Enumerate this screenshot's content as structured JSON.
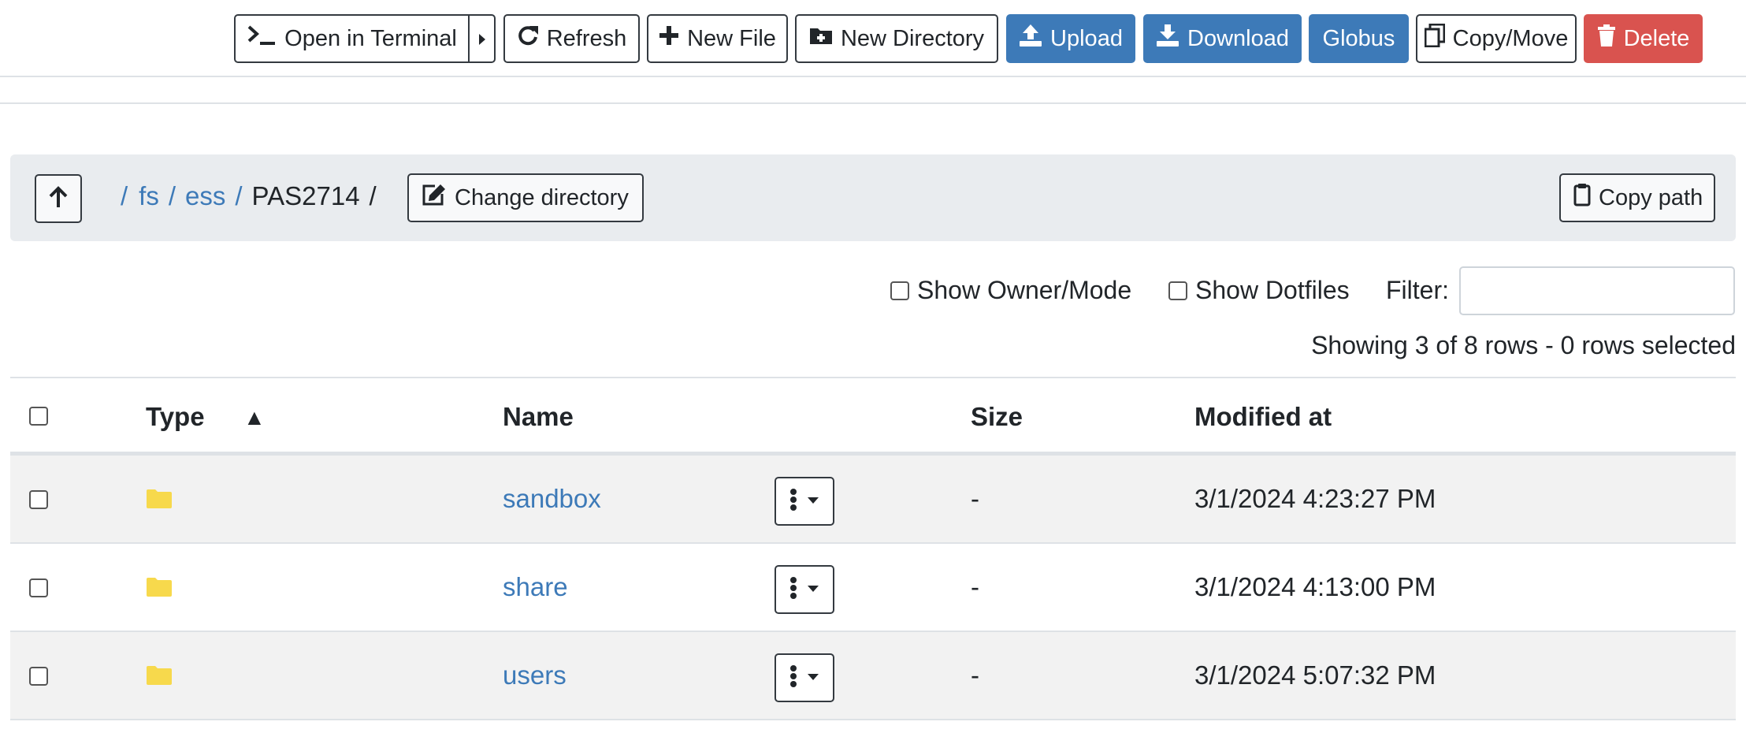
{
  "toolbar": {
    "open_terminal": "Open in Terminal",
    "refresh": "Refresh",
    "new_file": "New File",
    "new_directory": "New Directory",
    "upload": "Upload",
    "download": "Download",
    "globus": "Globus",
    "copy_move": "Copy/Move",
    "delete": "Delete"
  },
  "path": {
    "crumbs": [
      "fs",
      "ess"
    ],
    "current": "PAS2714",
    "root_sep": "/",
    "sep": "/",
    "change_directory": "Change directory",
    "copy_path": "Copy path"
  },
  "options": {
    "show_owner_mode": "Show Owner/Mode",
    "show_dotfiles": "Show Dotfiles",
    "filter_label": "Filter:",
    "filter_value": "",
    "info": "Showing 3 of 8 rows - 0 rows selected"
  },
  "table": {
    "headers": {
      "type": "Type",
      "sort_indicator": "▲",
      "name": "Name",
      "size": "Size",
      "modified": "Modified at"
    },
    "rows": [
      {
        "name": "sandbox",
        "size": "-",
        "modified": "3/1/2024 4:23:27 PM"
      },
      {
        "name": "share",
        "size": "-",
        "modified": "3/1/2024 4:13:00 PM"
      },
      {
        "name": "users",
        "size": "-",
        "modified": "3/1/2024 5:07:32 PM"
      }
    ]
  },
  "colors": {
    "primary": "#3d7ab8",
    "danger": "#d9534f",
    "folder": "#f7d94c",
    "path_bar": "#e9ecef",
    "row_stripe": "#f2f2f2"
  },
  "icons": {
    "terminal": "terminal-icon",
    "refresh": "refresh-icon",
    "new_file": "plus-icon",
    "new_directory": "folder-plus-icon",
    "upload": "upload-icon",
    "download": "download-icon",
    "copy_move": "copy-icon",
    "delete": "trash-icon",
    "up": "arrow-up-icon",
    "change_directory": "edit-icon",
    "copy_path": "clipboard-icon",
    "folder": "folder-icon",
    "row_menu": "kebab-menu-icon"
  }
}
